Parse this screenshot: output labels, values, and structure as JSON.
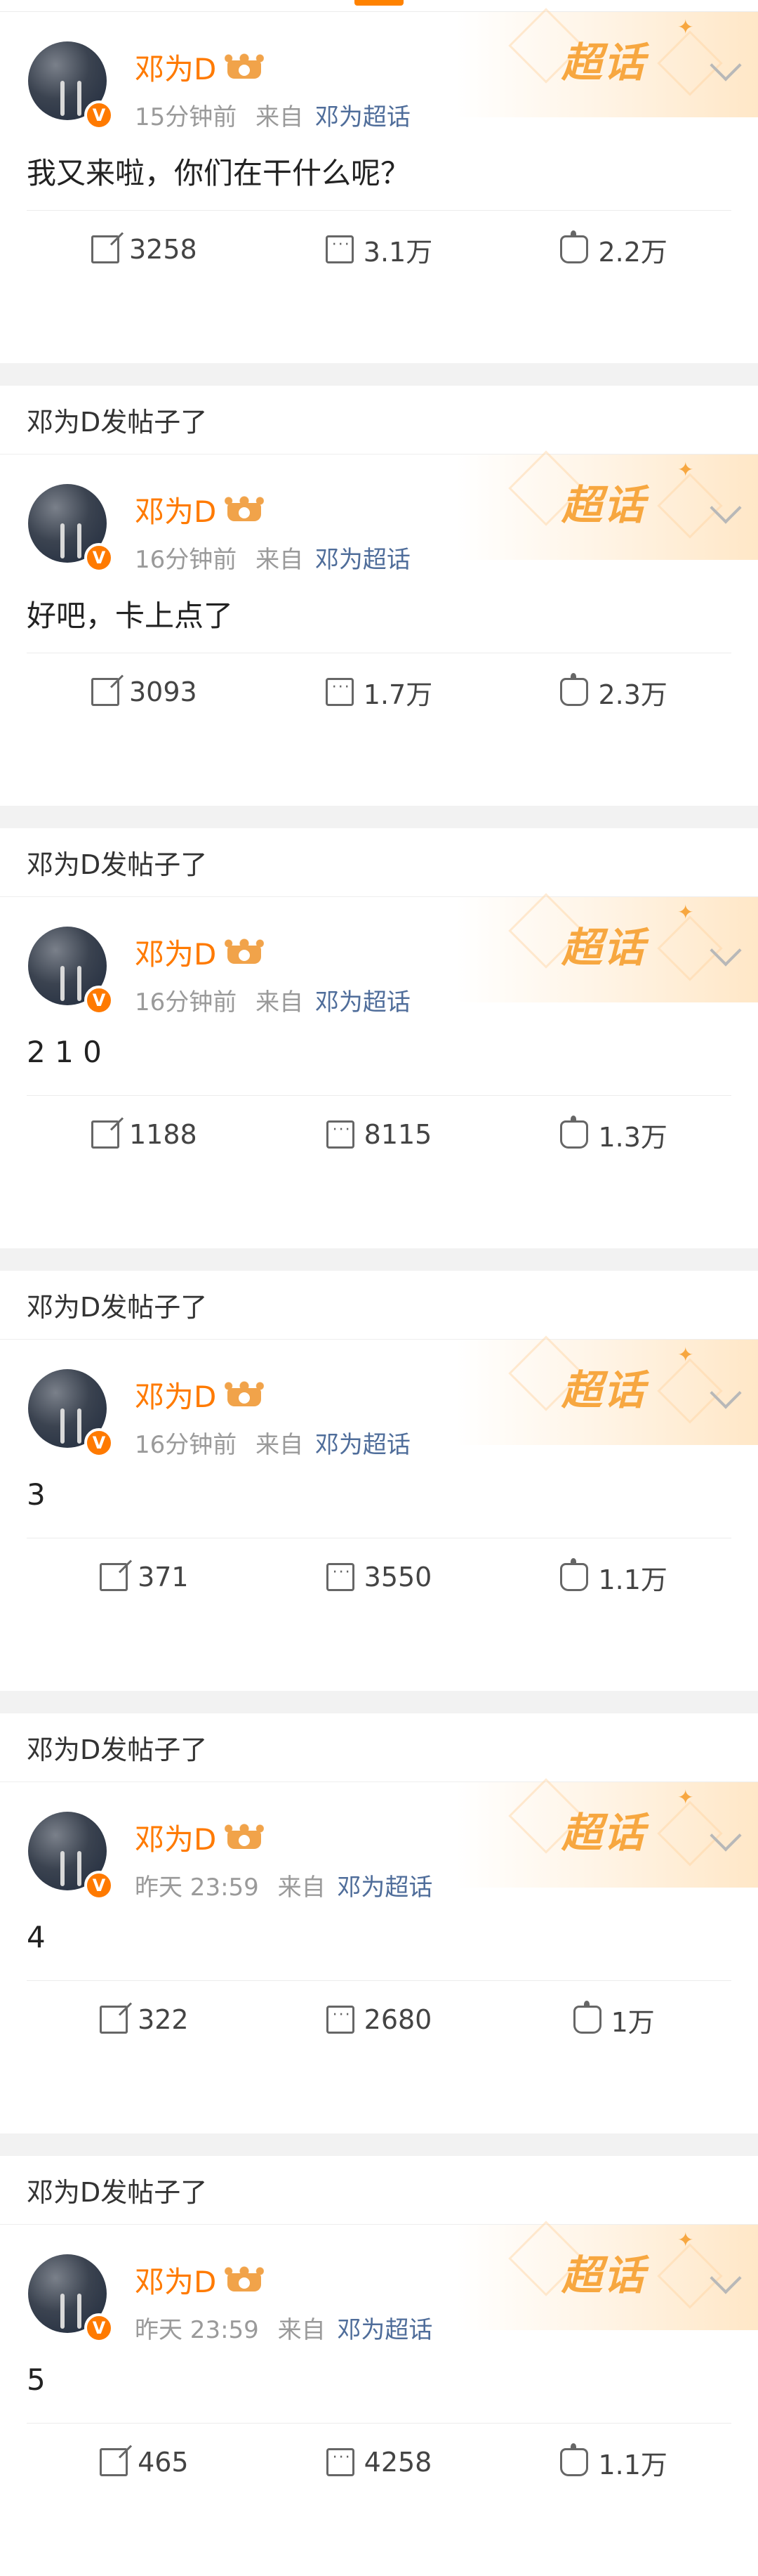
{
  "posts": [
    {
      "head": "",
      "user": "邓为D",
      "time": "15分钟前",
      "from": "来自",
      "source": "邓为超话",
      "content": "我又来啦，你们在干什么呢？",
      "share": "3258",
      "comments": "3.1万",
      "likes": "2.2万"
    },
    {
      "head": "邓为D发帖子了",
      "user": "邓为D",
      "time": "16分钟前",
      "from": "来自",
      "source": "邓为超话",
      "content": "好吧，卡上点了",
      "share": "3093",
      "comments": "1.7万",
      "likes": "2.3万"
    },
    {
      "head": "邓为D发帖子了",
      "user": "邓为D",
      "time": "16分钟前",
      "from": "来自",
      "source": "邓为超话",
      "content": "2 1 0",
      "share": "1188",
      "comments": "8115",
      "likes": "1.3万"
    },
    {
      "head": "邓为D发帖子了",
      "user": "邓为D",
      "time": "16分钟前",
      "from": "来自",
      "source": "邓为超话",
      "content": "3",
      "share": "371",
      "comments": "3550",
      "likes": "1.1万"
    },
    {
      "head": "邓为D发帖子了",
      "user": "邓为D",
      "time": "昨天 23:59",
      "from": "来自",
      "source": "邓为超话",
      "content": "4",
      "share": "322",
      "comments": "2680",
      "likes": "1万"
    },
    {
      "head": "邓为D发帖子了",
      "user": "邓为D",
      "time": "昨天 23:59",
      "from": "来自",
      "source": "邓为超话",
      "content": "5",
      "share": "465",
      "comments": "4258",
      "likes": "1.1万"
    }
  ],
  "banner_label": "超话",
  "verified_badge": "V",
  "colors": {
    "accent": "#ff7a00",
    "link": "#4f6d9a"
  }
}
